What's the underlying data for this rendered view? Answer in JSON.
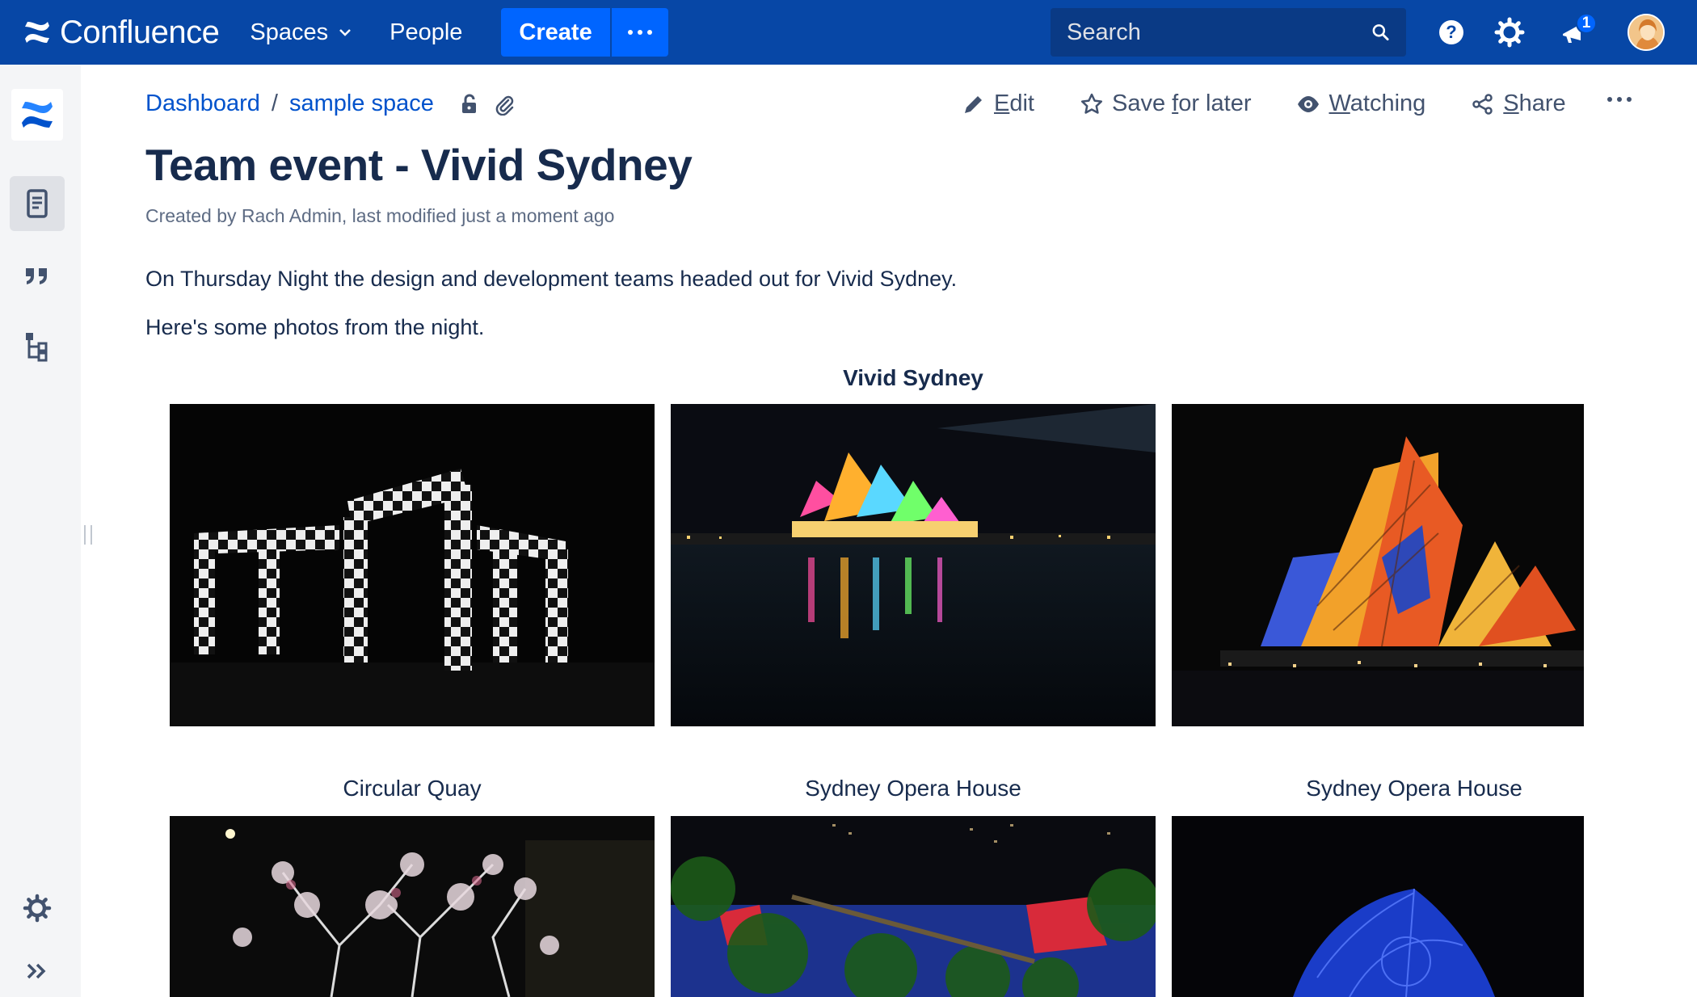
{
  "header": {
    "logo_text": "Confluence",
    "nav": {
      "spaces": "Spaces",
      "people": "People"
    },
    "create_label": "Create",
    "search_placeholder": "Search",
    "notification_count": "1"
  },
  "breadcrumb": {
    "dashboard": "Dashboard",
    "separator": "/",
    "space": "sample space"
  },
  "page_actions": {
    "edit": {
      "pre": "",
      "u": "E",
      "post": "dit"
    },
    "save": {
      "pre": "Save ",
      "u": "f",
      "post": "or later"
    },
    "watch": {
      "pre": "",
      "u": "W",
      "post": "atching"
    },
    "share": {
      "pre": "",
      "u": "S",
      "post": "hare"
    }
  },
  "page": {
    "title": "Team event - Vivid Sydney",
    "byline": "Created by Rach Admin, last modified just a moment ago",
    "paragraphs": [
      "On Thursday Night the design and development teams headed out for Vivid Sydney.",
      "Here's some photos from the night."
    ]
  },
  "gallery": {
    "title": "Vivid Sydney",
    "captions": [
      "Circular Quay",
      "Sydney Opera House",
      "Sydney Opera House"
    ]
  },
  "colors": {
    "nav_bg": "#0747a6",
    "create_bg": "#0065ff",
    "link": "#0052cc",
    "sidebar_bg": "#f4f5f7"
  }
}
